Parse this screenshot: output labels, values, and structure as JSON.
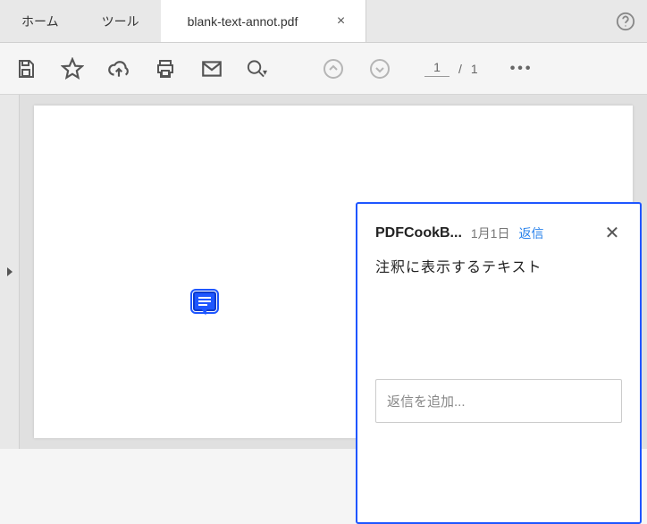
{
  "tabs": {
    "home": "ホーム",
    "tools": "ツール",
    "file": "blank-text-annot.pdf"
  },
  "page": {
    "current": "1",
    "sep": "/",
    "total": "1"
  },
  "annotation": {
    "author": "PDFCookB...",
    "date": "1月1日",
    "reply_label": "返信",
    "text": "注釈に表示するテキスト",
    "reply_placeholder": "返信を追加..."
  }
}
